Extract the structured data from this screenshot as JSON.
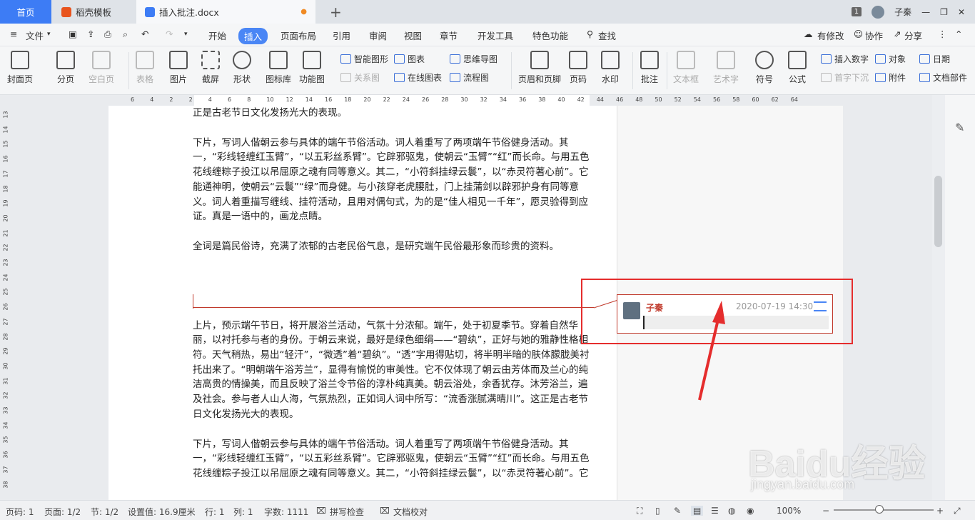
{
  "tabs": {
    "home": "首页",
    "template": "稻壳模板",
    "document": "插入批注.docx",
    "add": "+"
  },
  "window": {
    "badge": "1",
    "user": "子秦"
  },
  "menubar": {
    "file": "文件",
    "items": [
      "开始",
      "插入",
      "页面布局",
      "引用",
      "审阅",
      "视图",
      "章节",
      "开发工具",
      "特色功能"
    ],
    "search": "查找",
    "modified": "有修改",
    "collab": "协作",
    "share": "分享"
  },
  "ribbon": {
    "cover": "封面页",
    "pagebreak": "分页",
    "blankpage": "空白页",
    "table": "表格",
    "picture": "图片",
    "screenshot": "截屏",
    "shape": "形状",
    "iconlib": "图标库",
    "funcchart": "功能图",
    "smartart": "智能图形",
    "chart": "图表",
    "mindmap": "思维导图",
    "relation": "关系图",
    "onlinechart": "在线图表",
    "flowchart": "流程图",
    "headerfooter": "页眉和页脚",
    "pagenum": "页码",
    "watermark": "水印",
    "comment": "批注",
    "textbox": "文本框",
    "wordart": "艺术字",
    "symbol": "符号",
    "formula": "公式",
    "insertnum": "插入数字",
    "dropcap": "首字下沉",
    "object": "对象",
    "attachment": "附件",
    "date": "日期",
    "docparts": "文档部件"
  },
  "ruler_top": [
    "6",
    "4",
    "2",
    "2",
    "4",
    "6",
    "8",
    "10",
    "12",
    "14",
    "16",
    "18",
    "20",
    "22",
    "24",
    "26",
    "28",
    "30",
    "32",
    "34",
    "36",
    "38",
    "40",
    "42",
    "44",
    "46",
    "48",
    "50",
    "52",
    "54",
    "56",
    "58",
    "60",
    "62",
    "64"
  ],
  "ruler_left": [
    "13",
    "14",
    "15",
    "16",
    "17",
    "18",
    "19",
    "20",
    "21",
    "22",
    "23",
    "24",
    "25",
    "26",
    "27",
    "28",
    "29",
    "30",
    "31",
    "32",
    "33",
    "34",
    "35",
    "36",
    "37",
    "38"
  ],
  "document": {
    "p1_line": "正是古老节日文化发扬光大的表现。",
    "p2": "下片，写词人偕朝云参与具体的端午节俗活动。词人着重写了两项端午节俗健身活动。其一，“彩线轻缠红玉臂”，“以五彩丝系臂”。它辟邪驱鬼，使朝云“玉臂”“红”而长命。与用五色花线缠粽子投江以吊屈原之魂有同等意义。其二，“小符斜挂绿云鬟”，以“赤灵符著心前”。它能通神明，使朝云“云鬟”“绿”而身健。与小孩穿老虎腰肚，门上挂蒲剑以辟邪护身有同等意义。词人着重描写缠线、挂符活动，且用对偶句式，为的是“佳人相见一千年”，愿灵验得到应证。真是一语中的，画龙点睛。",
    "p3": "全词是篇民俗诗，充满了浓郁的古老民俗气息，是研究端午民俗最形象而珍贵的资料。",
    "p4": "上片，预示端午节日，将开展浴兰活动，气氛十分浓郁。端午，处于初夏季节。穿着自然华丽，以衬托参与者的身份。于朝云来说，最好是绿色细绢——“碧纨”，正好与她的雅静性格相符。天气稍热，易出“轻汗”，“微透”着“碧纨”。“透”字用得贴切，将半明半暗的肤体朦胧美衬托出来了。“明朝端午浴芳兰”，显得有愉悦的审美性。它不仅体现了朝云由芳体而及兰心的纯洁高贵的情操美，而且反映了浴兰令节俗的淳朴纯真美。朝云浴处，余香犹存。沐芳浴兰，遍及社会。参与者人山人海，气氛热烈，正如词人词中所写：“流香涨腻满晴川”。这正是古老节日文化发扬光大的表现。",
    "p5": "下片，写词人偕朝云参与具体的端午节俗活动。词人着重写了两项端午节俗健身活动。其一，“彩线轻缠红玉臂”，“以五彩丝系臂”。它辟邪驱鬼，使朝云“玉臂”“红”而长命。与用五色花线缠粽子投江以吊屈原之魂有同等意义。其二，“小符斜挂绿云鬟”，以“赤灵符著心前”。它"
  },
  "comment": {
    "user": "子秦",
    "time": "2020-07-19 14:30"
  },
  "status": {
    "pagenum": "页码: 1",
    "page": "页面: 1/2",
    "section": "节: 1/2",
    "setting": "设置值: 16.9厘米",
    "row": "行: 1",
    "col": "列: 1",
    "wordcount": "字数: 1111",
    "spellcheck": "拼写检查",
    "proofread": "文档校对",
    "zoom": "100%"
  },
  "watermark": {
    "logo": "Baidu经验",
    "url": "jingyan.baidu.com"
  },
  "colors": {
    "accent": "#3d7cf5",
    "comment_red": "#c0392b",
    "highlight_red": "#e52d2d"
  }
}
